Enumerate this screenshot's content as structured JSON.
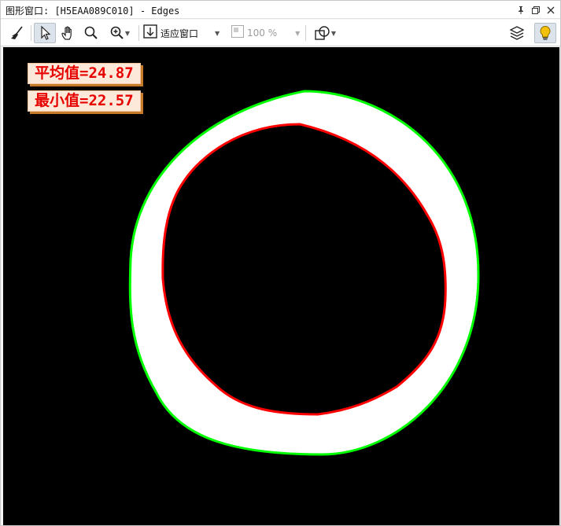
{
  "window": {
    "title": "图形窗口: [H5EAA089C010] - Edges",
    "pin_icon": "pin-icon",
    "restore_icon": "restore-window-icon",
    "close_icon": "close-icon"
  },
  "toolbar": {
    "broom_icon": "broom-icon",
    "pointer_icon": "pointer-icon",
    "hand_icon": "hand-pan-icon",
    "zoom_icon": "magnifier-icon",
    "zoom_in_icon": "zoom-in-icon",
    "fit_icon": "fit-window-icon",
    "fit_label": "适应窗口",
    "zoom_value": "100 %",
    "shape_icon": "shape-overlay-icon",
    "layers_icon": "layers-icon",
    "bulb_icon": "lightbulb-icon"
  },
  "overlay": {
    "mean_label": "平均值=24.87",
    "min_label": "最小值=22.57"
  },
  "colors": {
    "outer_edge": "#00ff00",
    "inner_edge": "#ff0000",
    "ring_fill": "#ffffff",
    "background": "#000000",
    "label_text": "#e60000",
    "label_bg": "#fde9d9"
  }
}
